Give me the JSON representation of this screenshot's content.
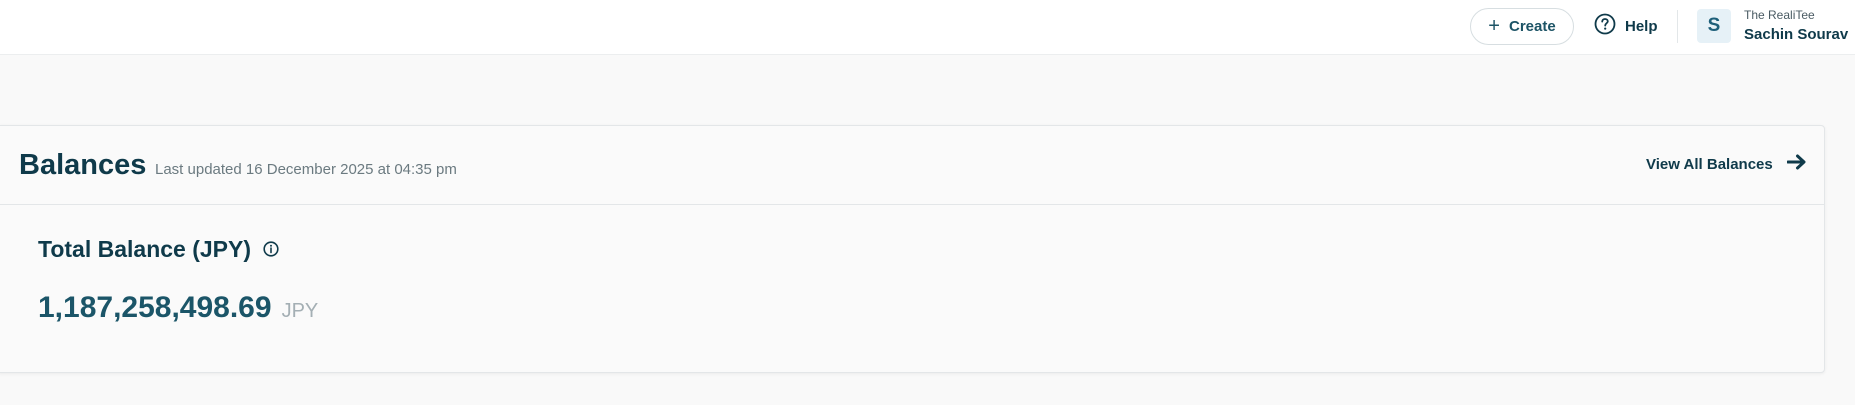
{
  "header": {
    "create_label": "Create",
    "help_label": "Help",
    "avatar_initial": "S",
    "org_name": "The RealiTee",
    "user_name": "Sachin Sourav"
  },
  "balances": {
    "title": "Balances",
    "last_updated": "Last updated 16 December 2025 at 04:35 pm",
    "view_all_label": "View All Balances",
    "total_label": "Total Balance (JPY)",
    "total_amount": "1,187,258,498.69",
    "currency": "JPY"
  },
  "icons": [
    "plus-icon",
    "help-circle-icon",
    "info-icon",
    "arrow-right-icon"
  ],
  "colors": {
    "primary_text": "#0f3a4a",
    "amount": "#1b5568",
    "avatar_bg": "#e6f1f7",
    "muted": "#6b7a80"
  }
}
